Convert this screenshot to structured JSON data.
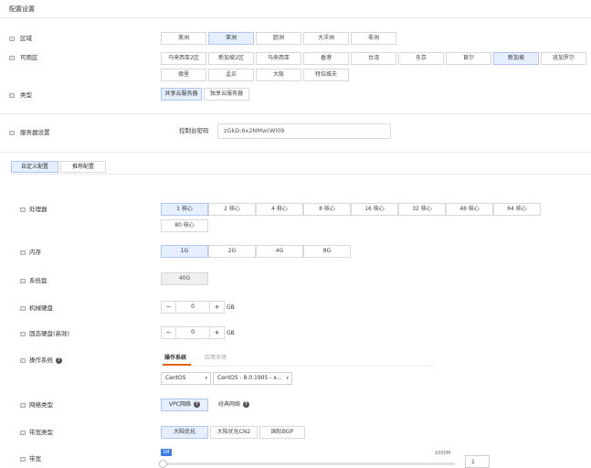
{
  "page_title": "配置设置",
  "region": {
    "label": "区域",
    "options": [
      "美洲",
      "亚洲",
      "欧洲",
      "大洋洲",
      "非洲"
    ],
    "selected": "亚洲"
  },
  "zone": {
    "label": "可用区",
    "options": [
      "马来西亚2区",
      "新加坡2区",
      "马来西亚",
      "香港",
      "台湾",
      "东京",
      "首尔",
      "新加坡",
      "班加罗尔",
      "德里",
      "孟买",
      "大阪",
      "特拉维夫"
    ],
    "selected": "新加坡"
  },
  "type": {
    "label": "类型",
    "options": [
      "共享云服务器",
      "独享云服务器"
    ],
    "selected": "共享云服务器"
  },
  "server_settings": {
    "label": "服务器设置",
    "console_password_label": "控制台密码",
    "console_password_value": "zGkD:6x2NMw(Wl09"
  },
  "config_tabs": {
    "custom": "自定义配置",
    "recommended": "推荐配置",
    "selected": "自定义配置"
  },
  "cpu": {
    "label": "处理器",
    "options": [
      "1 核心",
      "2 核心",
      "4 核心",
      "8 核心",
      "16 核心",
      "32 核心",
      "48 核心",
      "64 核心",
      "80 核心"
    ],
    "selected": "1 核心"
  },
  "memory": {
    "label": "内存",
    "options": [
      "1G",
      "2G",
      "4G",
      "8G"
    ],
    "selected": "1G"
  },
  "system_disk": {
    "label": "系统盘",
    "value": "40G"
  },
  "hdd": {
    "label": "机械硬盘",
    "minus": "−",
    "plus": "+",
    "value": "0",
    "unit": "GB"
  },
  "ssd": {
    "label": "固态硬盘(高效)",
    "minus": "−",
    "plus": "+",
    "value": "0",
    "unit": "GB"
  },
  "os": {
    "label": "操作系统",
    "help_icon": "?",
    "tab_os": "操作系统",
    "tab_market": "应用市场",
    "os_select": "CentOS",
    "version_select": "CentOS - 8.0.1905 - x...",
    "caret": "▾"
  },
  "network_type": {
    "label": "网络类型",
    "options": [
      "VPC网络",
      "经典网络"
    ],
    "help_icon": "?",
    "selected": "VPC网络"
  },
  "bandwidth_type": {
    "label": "带宽类型",
    "options": [
      "大陆优化",
      "大陆优化CN2",
      "国际BGP"
    ],
    "selected": "大陆优化"
  },
  "bandwidth": {
    "label": "带宽",
    "min_badge": "1M",
    "max_label": "1000M",
    "level": 0.0,
    "input_value": "1"
  },
  "colors": {
    "selected_bg": "#e6efff",
    "accent_orange": "#e8670c",
    "slider_blue": "#3b7de8"
  }
}
